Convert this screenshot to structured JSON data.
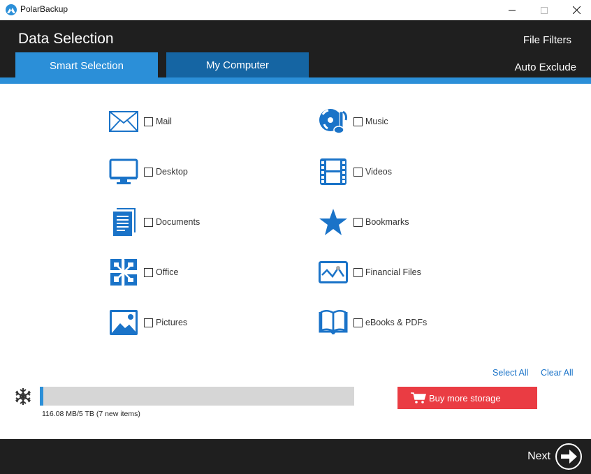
{
  "window": {
    "app_title": "PolarBackup",
    "logo_icon": "polarbackup-mountain-logo",
    "controls": {
      "minimize": "minimize-icon",
      "maximize": "maximize-icon",
      "close": "close-icon"
    }
  },
  "header": {
    "title": "Data Selection",
    "tabs": [
      {
        "label": "Smart Selection",
        "active": true
      },
      {
        "label": "My Computer",
        "active": false
      }
    ],
    "links": {
      "file_filters": "File Filters",
      "auto_exclude": "Auto Exclude"
    }
  },
  "categories": {
    "left": [
      {
        "label": "Mail",
        "icon": "mail-icon",
        "checked": false
      },
      {
        "label": "Desktop",
        "icon": "desktop-icon",
        "checked": false
      },
      {
        "label": "Documents",
        "icon": "documents-icon",
        "checked": false
      },
      {
        "label": "Office",
        "icon": "office-icon",
        "checked": false
      },
      {
        "label": "Pictures",
        "icon": "pictures-icon",
        "checked": false
      }
    ],
    "right": [
      {
        "label": "Music",
        "icon": "music-icon",
        "checked": false
      },
      {
        "label": "Videos",
        "icon": "videos-icon",
        "checked": false
      },
      {
        "label": "Bookmarks",
        "icon": "bookmarks-icon",
        "checked": false
      },
      {
        "label": "Financial Files",
        "icon": "financial-files-icon",
        "checked": false
      },
      {
        "label": "eBooks & PDFs",
        "icon": "ebooks-icon",
        "checked": false
      }
    ]
  },
  "selection_actions": {
    "select_all": "Select All",
    "clear_all": "Clear All"
  },
  "storage": {
    "usage_text": "116.08 MB/5 TB (7 new items)",
    "used_fraction": 0.01,
    "icon": "snowflake-icon"
  },
  "buy_storage": {
    "label": "Buy more storage",
    "icon": "cart-icon"
  },
  "footer": {
    "next_label": "Next",
    "next_icon": "arrow-right-circle-icon"
  },
  "colors": {
    "accent_blue": "#2b8fd8",
    "tab_inactive": "#1565a3",
    "header_bg": "#1f1f1f",
    "icon_blue": "#1a73c8",
    "buy_red": "#ea3c43"
  }
}
